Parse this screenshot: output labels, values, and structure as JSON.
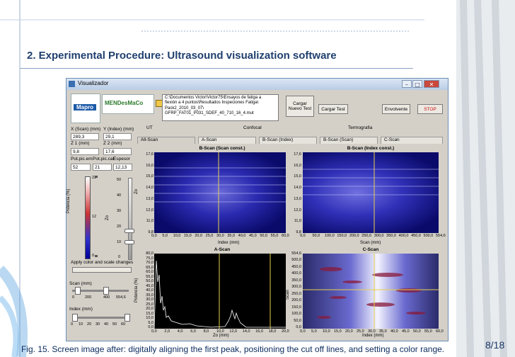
{
  "slide": {
    "title": "2. Experimental Procedure: Ultrasound visualization software",
    "caption": "Fig. 15. Screen image after: digitally aligning the first peak, positioning the cut off lines, and setting a color range.",
    "page": "8/18"
  },
  "window": {
    "title": "Visualizador",
    "logo_text": "Mapro",
    "brand_text": "MENDesMaCo",
    "path_lines": [
      "C:\\Documentos Victor\\Victor75\\Ensayos de fatiga a",
      "flexión a 4 puntos\\Resultados Inspeciones Fatiga\\",
      "Pack2_2010_03_07\\",
      "GFRP_FAT01_P031_SDEF_40_710_16_4.mut"
    ],
    "buttons": {
      "load_new": "Cargar Nuevo Test",
      "load": "Cargar Test",
      "envelope": "Envolvente",
      "stop": "STOP"
    },
    "sections": {
      "ut": "UT",
      "confocal": "Confocal",
      "thermography": "Termografia"
    },
    "tabs": [
      "All-Scan",
      "A-Scan",
      "B-Scan (Index)",
      "B-Scan (Scan)",
      "C-Scan"
    ],
    "fields": [
      {
        "label": "X (Scan) (mm)",
        "value": "289,3"
      },
      {
        "label": "Y (Index) (mm)",
        "value": "29,1"
      },
      {
        "label": "Z 1 (mm)",
        "value": "9,8"
      },
      {
        "label": "Z 2 (mm)",
        "value": "17,6"
      },
      {
        "label": "Pot.pic.em",
        "value": "52"
      },
      {
        "label": "Pot.pic.cal",
        "value": "21"
      },
      {
        "label": "Espesor",
        "value": "12,13"
      }
    ],
    "color_scale_max": "23",
    "color_scale_mid": "12",
    "color_scale_min": "0",
    "color_scale_label": "Potencia (%)",
    "z_slider_label": "Zo",
    "z_ticks": [
      "50",
      "40",
      "30",
      "20",
      "10",
      "0"
    ],
    "apply_label": "Apply color and scale changes",
    "scan_slider": {
      "label": "Scan (mm)",
      "ticks": [
        "0",
        "200",
        "400",
        "554,6"
      ]
    },
    "index_slider": {
      "label": "Index (mm)",
      "ticks": [
        "0",
        "10",
        "20",
        "30",
        "40",
        "50",
        "60"
      ]
    },
    "bscan_scan": {
      "title": "B-Scan (Scan const.)",
      "xlabel": "Index (mm)",
      "ylabel": "Zo",
      "yticks": [
        "17,6",
        "16,0",
        "15,0",
        "14,0",
        "13,0",
        "12,0",
        "11,0",
        "9,8"
      ],
      "xticks": [
        "0,0",
        "5,0",
        "10,0",
        "15,0",
        "20,0",
        "25,0",
        "30,0",
        "35,0",
        "40,0",
        "45,0",
        "50,0",
        "55,0",
        "60,0"
      ]
    },
    "bscan_index": {
      "title": "B-Scan (Index const.)",
      "xlabel": "Scan (mm)",
      "yticks": [
        "17,6",
        "16,0",
        "15,0",
        "14,0",
        "13,0",
        "12,0",
        "11,0",
        "9,8"
      ],
      "xticks": [
        "0,0",
        "50,0",
        "100,0",
        "150,0",
        "200,0",
        "250,0",
        "300,0",
        "350,0",
        "400,0",
        "450,0",
        "500,0",
        "554,6"
      ]
    },
    "ascan": {
      "title": "A-Scan",
      "xlabel": "Zo (mm)",
      "ylabel": "Potencia (%)",
      "yticks": [
        "80,0",
        "75,0",
        "70,0",
        "65,0",
        "60,0",
        "55,0",
        "50,0",
        "45,0",
        "40,0",
        "35,0",
        "30,0",
        "25,0",
        "20,0",
        "15,0",
        "10,0",
        "5,0",
        "0,0"
      ],
      "xticks": [
        "0,0",
        "2,0",
        "4,0",
        "6,0",
        "8,0",
        "10,0",
        "12,0",
        "14,0",
        "16,0",
        "18,0",
        "20,0"
      ]
    },
    "cscan": {
      "title": "C-Scan",
      "xlabel": "Index (mm)",
      "ylabel": "Scan",
      "yticks": [
        "554,6",
        "500,0",
        "450,0",
        "400,0",
        "350,0",
        "300,0",
        "250,0",
        "200,0",
        "150,0",
        "100,0",
        "50,0",
        "0,0"
      ],
      "xticks": [
        "0,0",
        "5,0",
        "10,0",
        "15,0",
        "20,0",
        "25,0",
        "30,0",
        "35,0",
        "40,0",
        "45,0",
        "50,0",
        "55,0",
        "60,0"
      ]
    },
    "colors": {
      "accent": "#1f3f6e",
      "cut_line": "#e6d24a",
      "bscan_bg": "#0a0a6a"
    }
  }
}
